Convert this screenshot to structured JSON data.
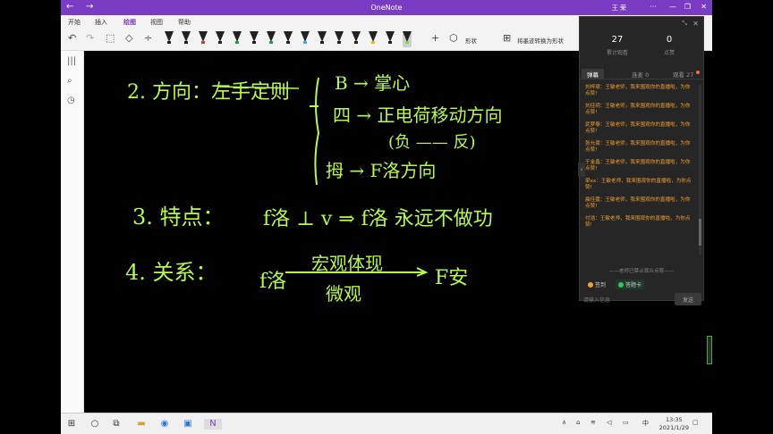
{
  "window": {
    "title": "OneNote",
    "user": "王 荣"
  },
  "menu": [
    {
      "label": "开始"
    },
    {
      "label": "插入"
    },
    {
      "label": "绘图",
      "active": true
    },
    {
      "label": "视图"
    },
    {
      "label": "帮助"
    }
  ],
  "toolbar": {
    "shape_label": "形状",
    "convert_label": "将墨迹转换为形状",
    "pen_colors": [
      "#222222",
      "#222222",
      "#d83a3a",
      "#222222",
      "#2a9a4a",
      "#222222",
      "#2a9a4a",
      "#222222",
      "#4aa8d8",
      "#222222",
      "#222222",
      "#222222",
      "#e0c020",
      "#222222",
      "#7fd84a"
    ]
  },
  "notes": {
    "line1": "2. 方向：左手定则",
    "line1_b": "B → 掌心",
    "line1_i": "四 → 正电荷移动方向",
    "line1_neg": "(负 —— 反)",
    "line1_thumb": "拇 → F洛方向",
    "line2": "3. 特点：",
    "line2_rest": "f洛 ⊥ v ⇒ f洛 永远不做功",
    "line3": "4. 关系：",
    "line3_f": "f洛",
    "line3_num": "宏观体现",
    "line3_den": "微观",
    "line3_rhs": "F安"
  },
  "chat": {
    "viewers_count": "27",
    "viewers_label": "累计观看",
    "likes_count": "0",
    "likes_label": "点赞",
    "tabs": [
      {
        "label": "弹幕",
        "active": true
      },
      {
        "label": "连麦 0"
      },
      {
        "label": "观看 27"
      }
    ],
    "messages": [
      "刘梓璟：王敏老师，我来围观你的直播啦，为你点赞!",
      "刘佳玥：王敏老师，我来围观你的直播啦，为你点赞!",
      "武梦泰：王敏老师，我来围观你的直播啦，为你点赞!",
      "张允豪：王敏老师，我来围观你的直播啦，为你点赞!",
      "于金鑫：王敏老师，我来围观你的直播啦，为你点赞!",
      "梁xx：王敏老师，我来围观你的直播啦，为你点赞!",
      "晨佳嘉：王敏老师，我来围观你的直播啦，为你点赞!",
      "付浩：王敏老师，我来围观你的直播啦，为你点赞!"
    ],
    "system_note": "——老师已禁止观众点赞——",
    "action_signin": "签到",
    "action_answer": "答题卡",
    "input_placeholder": "请输入信息",
    "send_label": "发送"
  },
  "taskbar": {
    "ime": "中",
    "time": "13:35",
    "date": "2021/1/29"
  }
}
